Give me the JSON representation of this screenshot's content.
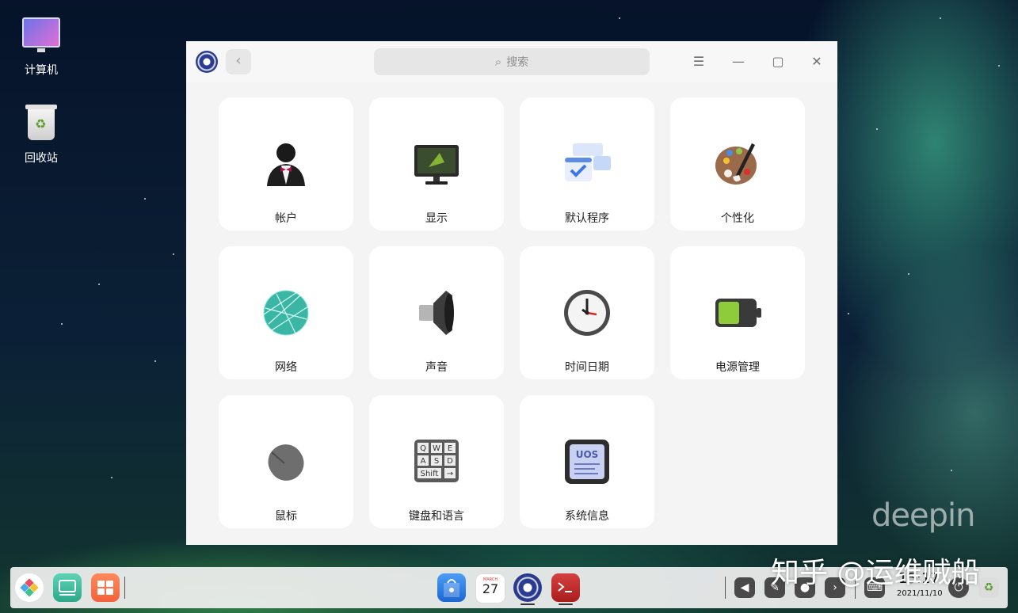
{
  "desktop": {
    "icons": [
      {
        "label": "计算机"
      },
      {
        "label": "回收站"
      }
    ],
    "watermark": "deepin",
    "overlay_text": "知乎 @运维贼船"
  },
  "window": {
    "search_placeholder": "搜索",
    "back_symbol": "‹",
    "menu_symbol": "☰",
    "minimize_symbol": "—",
    "maximize_symbol": "▢",
    "close_symbol": "✕",
    "modules": [
      {
        "label": "帐户",
        "icon": "account-icon"
      },
      {
        "label": "显示",
        "icon": "display-icon"
      },
      {
        "label": "默认程序",
        "icon": "default-apps-icon"
      },
      {
        "label": "个性化",
        "icon": "personalization-icon"
      },
      {
        "label": "网络",
        "icon": "network-icon"
      },
      {
        "label": "声音",
        "icon": "sound-icon"
      },
      {
        "label": "时间日期",
        "icon": "datetime-icon"
      },
      {
        "label": "电源管理",
        "icon": "power-icon"
      },
      {
        "label": "鼠标",
        "icon": "mouse-icon"
      },
      {
        "label": "键盘和语言",
        "icon": "keyboard-icon"
      },
      {
        "label": "系统信息",
        "icon": "system-info-icon"
      }
    ],
    "keyboard_keys": [
      "Q",
      "W",
      "E",
      "A",
      "S",
      "D",
      "Shift",
      "→"
    ],
    "sysinfo_text": "UOS"
  },
  "dock": {
    "calendar_month": "MARCH",
    "calendar_day": "27",
    "clock_time": "15:17",
    "clock_date": "2021/11/10"
  },
  "colors": {
    "window_bg": "#f4f4f4",
    "card_bg": "#ffffff",
    "accent": "#2b3b8f"
  }
}
